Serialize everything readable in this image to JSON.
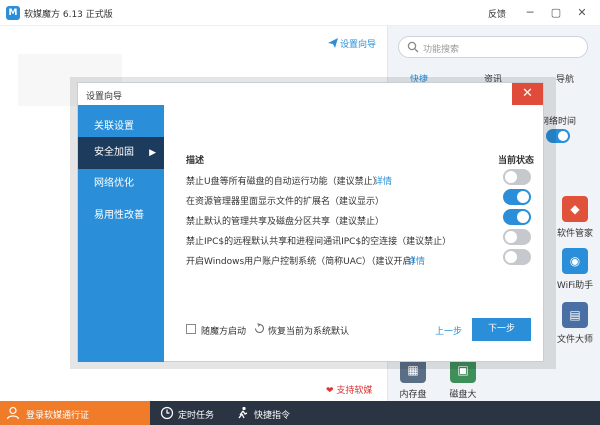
{
  "app": {
    "title": "软媒魔方 6.13 正式版",
    "feedback": "反馈",
    "logo": "M",
    "minimize_glyph": "─",
    "maximize_glyph": "▢",
    "close_glyph": "✕"
  },
  "main": {
    "setup_wizard_link": "设置向导",
    "support_link": "支持软媒"
  },
  "right_panel": {
    "search_placeholder": "功能搜索",
    "tabs": [
      {
        "label": "快捷",
        "active": true
      },
      {
        "label": "资讯",
        "active": false
      },
      {
        "label": "导航",
        "active": false
      }
    ],
    "network_time_label": "网络时间",
    "tools": [
      {
        "label": "软件管家",
        "icon": "software-manager-icon",
        "color": "#e0533a"
      },
      {
        "label": "WiFi助手",
        "icon": "wifi-assistant-icon",
        "color": "#2a8fd8"
      },
      {
        "label": "文件大师",
        "icon": "file-master-icon",
        "color": "#4a6fa5"
      },
      {
        "label": "内存盘",
        "icon": "ram-disk-icon",
        "color": "#5a6f86"
      },
      {
        "label": "磁盘大",
        "icon": "disk-icon",
        "color": "#3f8f5b"
      }
    ]
  },
  "dialog": {
    "title": "设置向导",
    "close_glyph": "✕",
    "sidebar": [
      {
        "label": "关联设置",
        "active": false
      },
      {
        "label": "安全加固",
        "active": true
      },
      {
        "label": "网络优化",
        "active": false
      },
      {
        "label": "易用性改善",
        "active": false
      }
    ],
    "active_arrow": "▶",
    "column_desc": "描述",
    "column_status": "当前状态",
    "rows": [
      {
        "text": "禁止U盘等所有磁盘的自动运行功能（建议禁止）",
        "link": "详情",
        "on": false
      },
      {
        "text": "在资源管理器里面显示文件的扩展名（建议显示）",
        "link": "",
        "on": true
      },
      {
        "text": "禁止默认的管理共享及磁盘分区共享（建议禁止）",
        "link": "",
        "on": true
      },
      {
        "text": "禁止IPC$的远程默认共享和进程间通讯IPC$的空连接（建议禁止）",
        "link": "",
        "on": false
      },
      {
        "text": "开启Windows用户账户控制系统（简称UAC）（建议开启）",
        "link": "详情",
        "on": false
      }
    ],
    "autostart_label": "随魔方启动",
    "restore_label": "恢复当前为系统默认",
    "prev_label": "上一步",
    "next_label": "下一步"
  },
  "bottom_bar": {
    "login_label": "登录软媒通行证",
    "scheduled_tasks": "定时任务",
    "shortcut_commands": "快捷指令"
  },
  "colors": {
    "accent": "#2a8fd8",
    "sidebar_active": "#1d3b5c",
    "close_red": "#e04b3a",
    "login_orange": "#f07c2a",
    "bottom_dark": "#2b3443"
  }
}
